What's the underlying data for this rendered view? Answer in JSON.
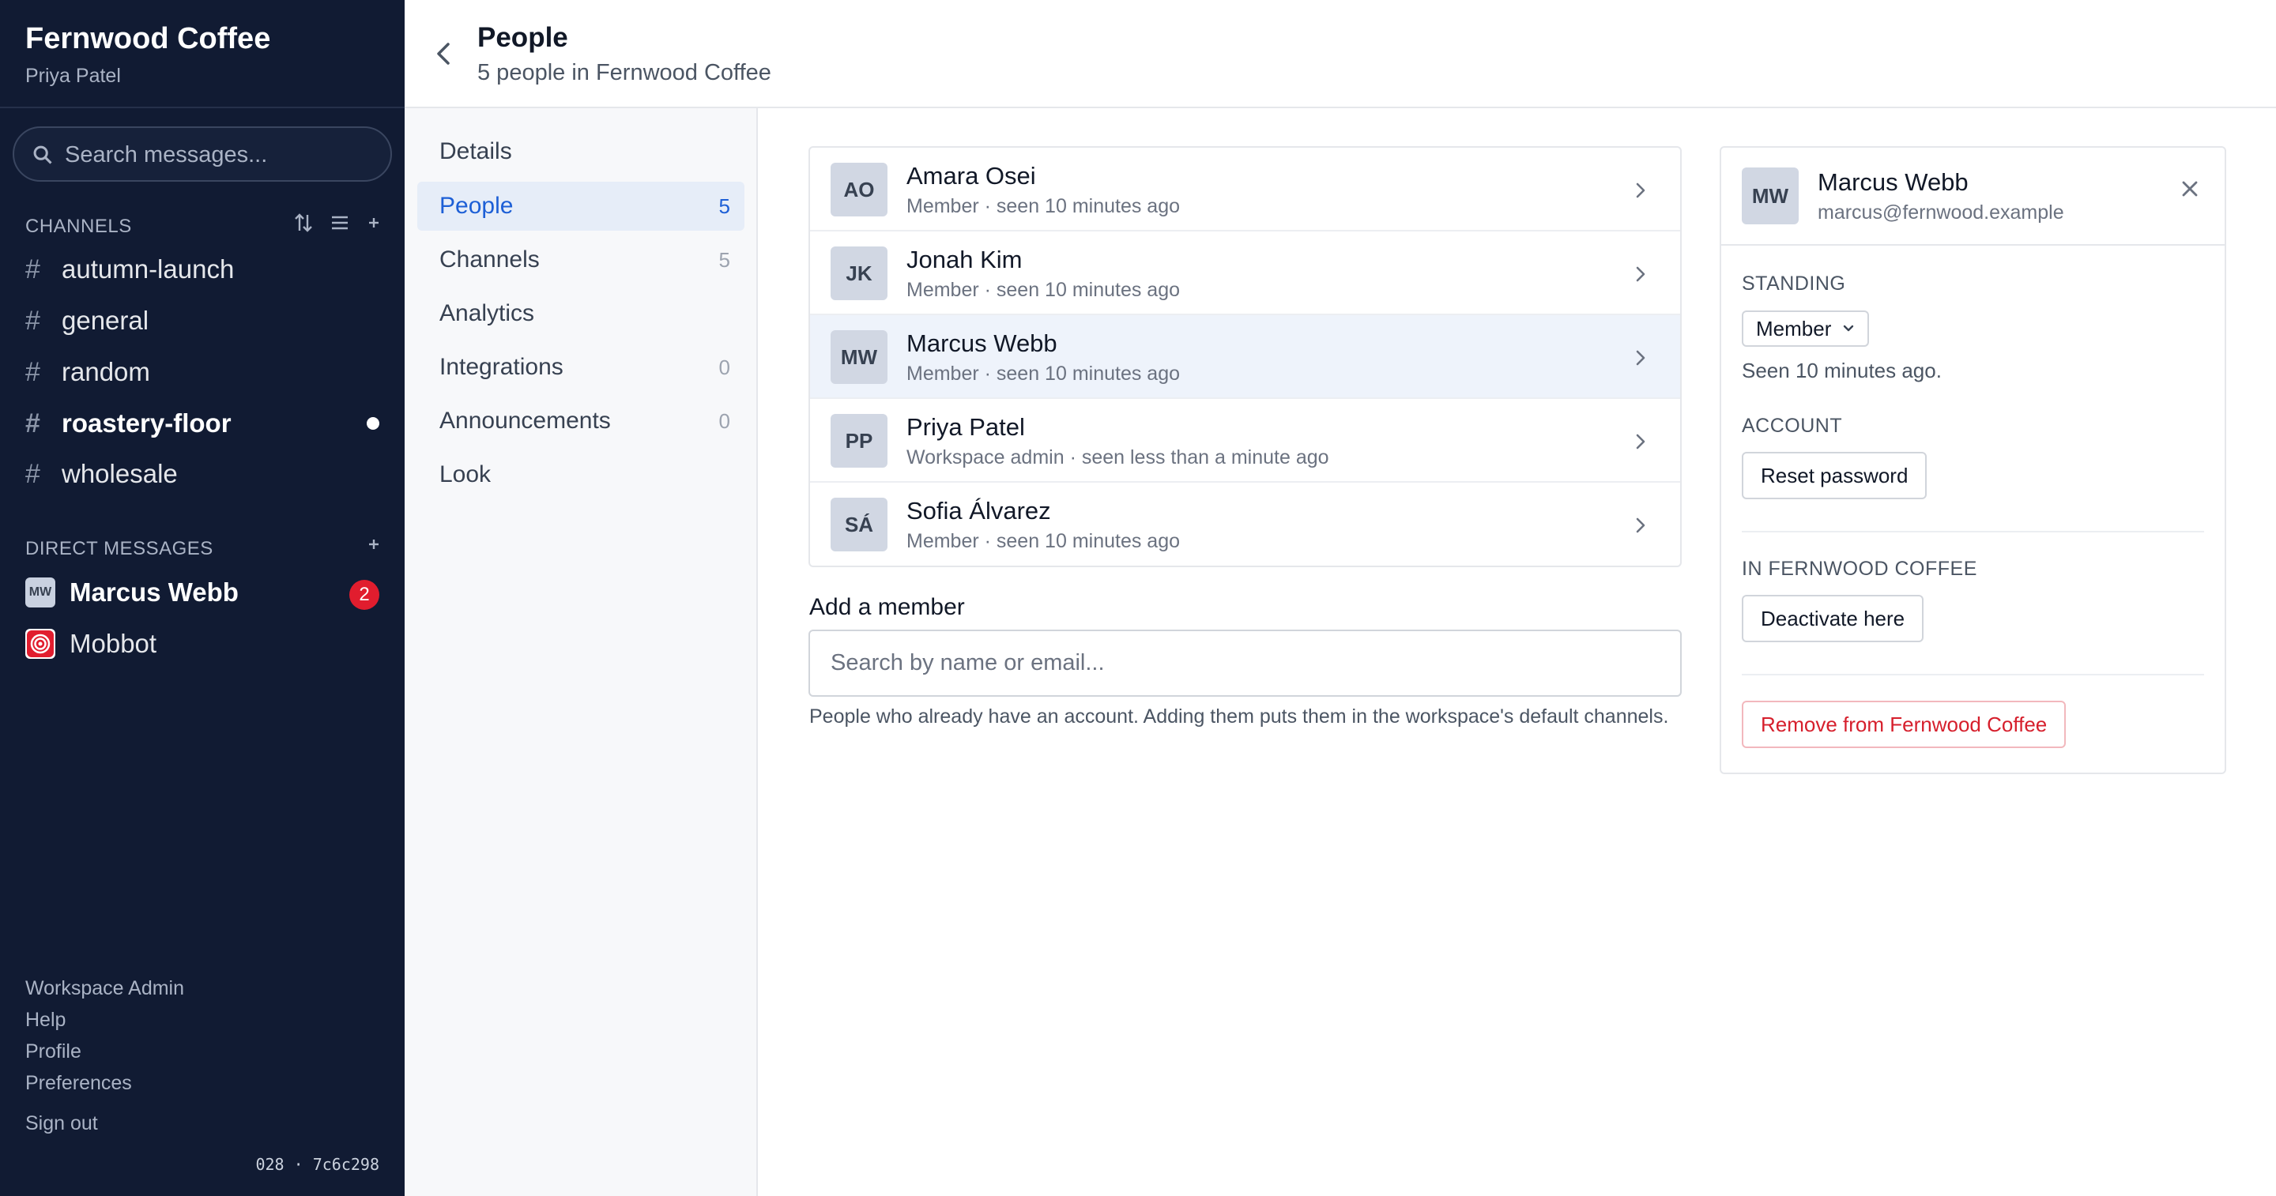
{
  "workspace": {
    "name": "Fernwood Coffee",
    "user": "Priya Patel"
  },
  "search": {
    "placeholder": "Search messages..."
  },
  "channels": {
    "label": "CHANNELS",
    "items": [
      {
        "name": "autumn-launch",
        "unread": false
      },
      {
        "name": "general",
        "unread": false
      },
      {
        "name": "random",
        "unread": false
      },
      {
        "name": "roastery-floor",
        "unread": true
      },
      {
        "name": "wholesale",
        "unread": false
      }
    ],
    "tool_icons": [
      "sort-icon",
      "list-icon",
      "plus-icon"
    ]
  },
  "direct_messages": {
    "label": "DIRECT MESSAGES",
    "items": [
      {
        "name": "Marcus Webb",
        "initials": "MW",
        "badge": "2"
      },
      {
        "name": "Mobbot",
        "icon": "bot-target-icon"
      }
    ]
  },
  "sidebar_footer": {
    "links": [
      "Workspace Admin",
      "Help",
      "Profile",
      "Preferences"
    ],
    "sign_out": "Sign out",
    "build": "028 · 7c6c298"
  },
  "header": {
    "title": "People",
    "subtitle": "5 people in Fernwood Coffee"
  },
  "settings_nav": [
    {
      "label": "Details",
      "count": ""
    },
    {
      "label": "People",
      "count": "5",
      "active": true
    },
    {
      "label": "Channels",
      "count": "5"
    },
    {
      "label": "Analytics",
      "count": ""
    },
    {
      "label": "Integrations",
      "count": "0"
    },
    {
      "label": "Announcements",
      "count": "0"
    },
    {
      "label": "Look",
      "count": ""
    }
  ],
  "people": [
    {
      "initials": "AO",
      "name": "Amara Osei",
      "meta": "Member · seen 10 minutes ago"
    },
    {
      "initials": "JK",
      "name": "Jonah Kim",
      "meta": "Member · seen 10 minutes ago"
    },
    {
      "initials": "MW",
      "name": "Marcus Webb",
      "meta": "Member · seen 10 minutes ago",
      "selected": true
    },
    {
      "initials": "PP",
      "name": "Priya Patel",
      "meta": "Workspace admin · seen less than a minute ago"
    },
    {
      "initials": "SÁ",
      "name": "Sofia Álvarez",
      "meta": "Member · seen 10 minutes ago"
    }
  ],
  "add_member": {
    "label": "Add a member",
    "placeholder": "Search by name or email...",
    "help": "People who already have an account. Adding them puts them in the workspace's default channels."
  },
  "detail": {
    "initials": "MW",
    "name": "Marcus Webb",
    "email": "marcus@fernwood.example",
    "standing_label": "STANDING",
    "standing_value": "Member",
    "seen": "Seen 10 minutes ago.",
    "account_label": "ACCOUNT",
    "reset_password": "Reset password",
    "in_workspace_label": "IN FERNWOOD COFFEE",
    "deactivate": "Deactivate here",
    "remove": "Remove from Fernwood Coffee"
  },
  "colors": {
    "sidebar_bg": "#111b33",
    "accent": "#1d5fd6",
    "danger": "#d61f2c",
    "badge": "#e11d2e"
  }
}
